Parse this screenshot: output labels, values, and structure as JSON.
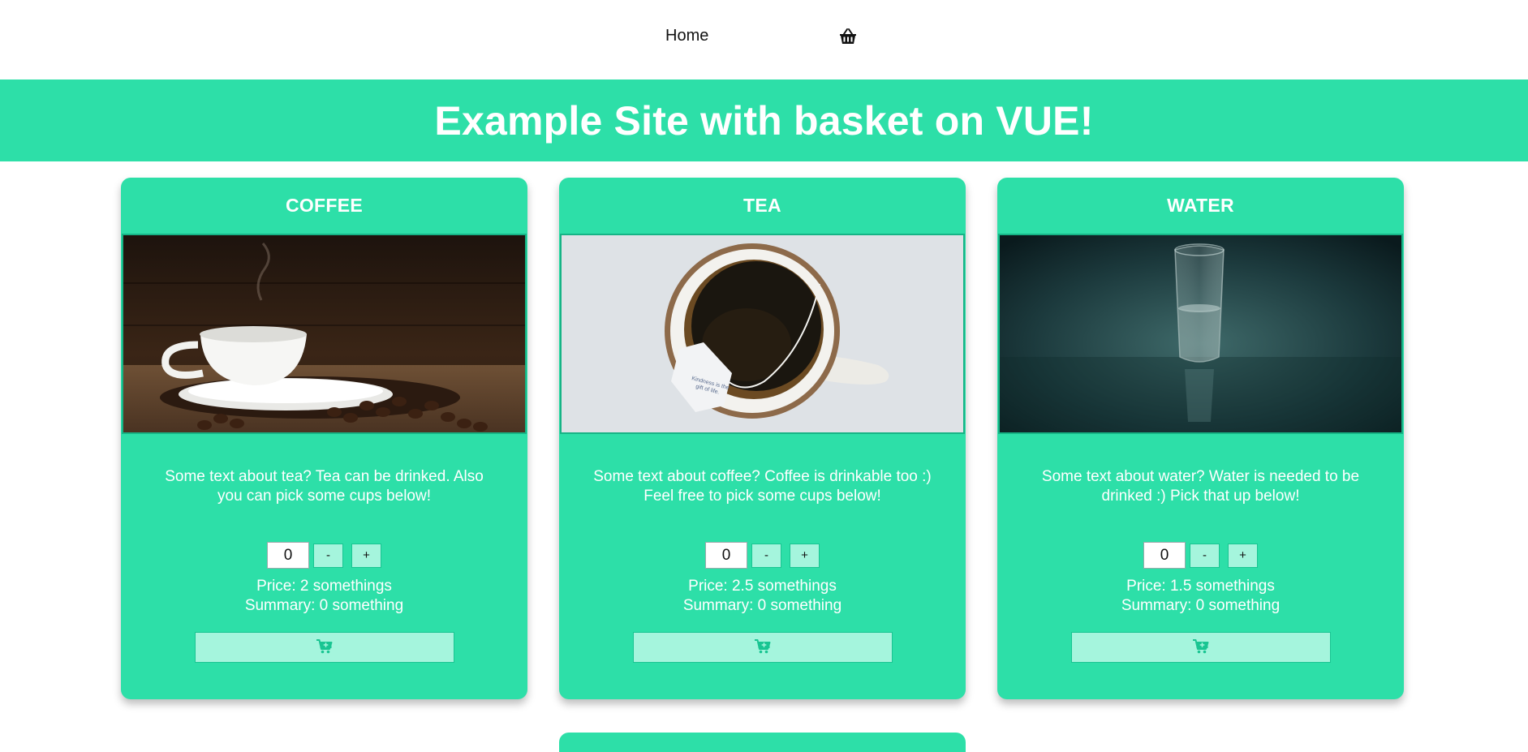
{
  "nav": {
    "home_label": "Home",
    "basket_icon": "basket-icon"
  },
  "banner": {
    "title": "Example Site with basket on VUE!"
  },
  "colors": {
    "accent": "#2ddfa8",
    "button_bg": "#a5f5dd",
    "button_border": "#19c592",
    "icon": "#19c592"
  },
  "products": [
    {
      "title": "COFFEE",
      "image": "coffee-cup-photo",
      "description": "Some text about tea? Tea can be drinked. Also you can pick some cups below!",
      "qty": "0",
      "minus_label": "-",
      "plus_label": "+",
      "price": "Price: 2 somethings",
      "summary": "Summary: 0 something",
      "cart_icon": "add-to-cart-icon"
    },
    {
      "title": "TEA",
      "image": "tea-cup-photo",
      "description": "Some text about coffee? Coffee is drinkable too :) Feel free to pick some cups below!",
      "qty": "0",
      "minus_label": "-",
      "plus_label": "+",
      "price": "Price: 2.5 somethings",
      "summary": "Summary: 0 something",
      "cart_icon": "add-to-cart-icon"
    },
    {
      "title": "WATER",
      "image": "water-glass-photo",
      "description": "Some text about water? Water is needed to be drinked :) Pick that up below!",
      "qty": "0",
      "minus_label": "-",
      "plus_label": "+",
      "price": "Price: 1.5 somethings",
      "summary": "Summary: 0 something",
      "cart_icon": "add-to-cart-icon"
    }
  ]
}
